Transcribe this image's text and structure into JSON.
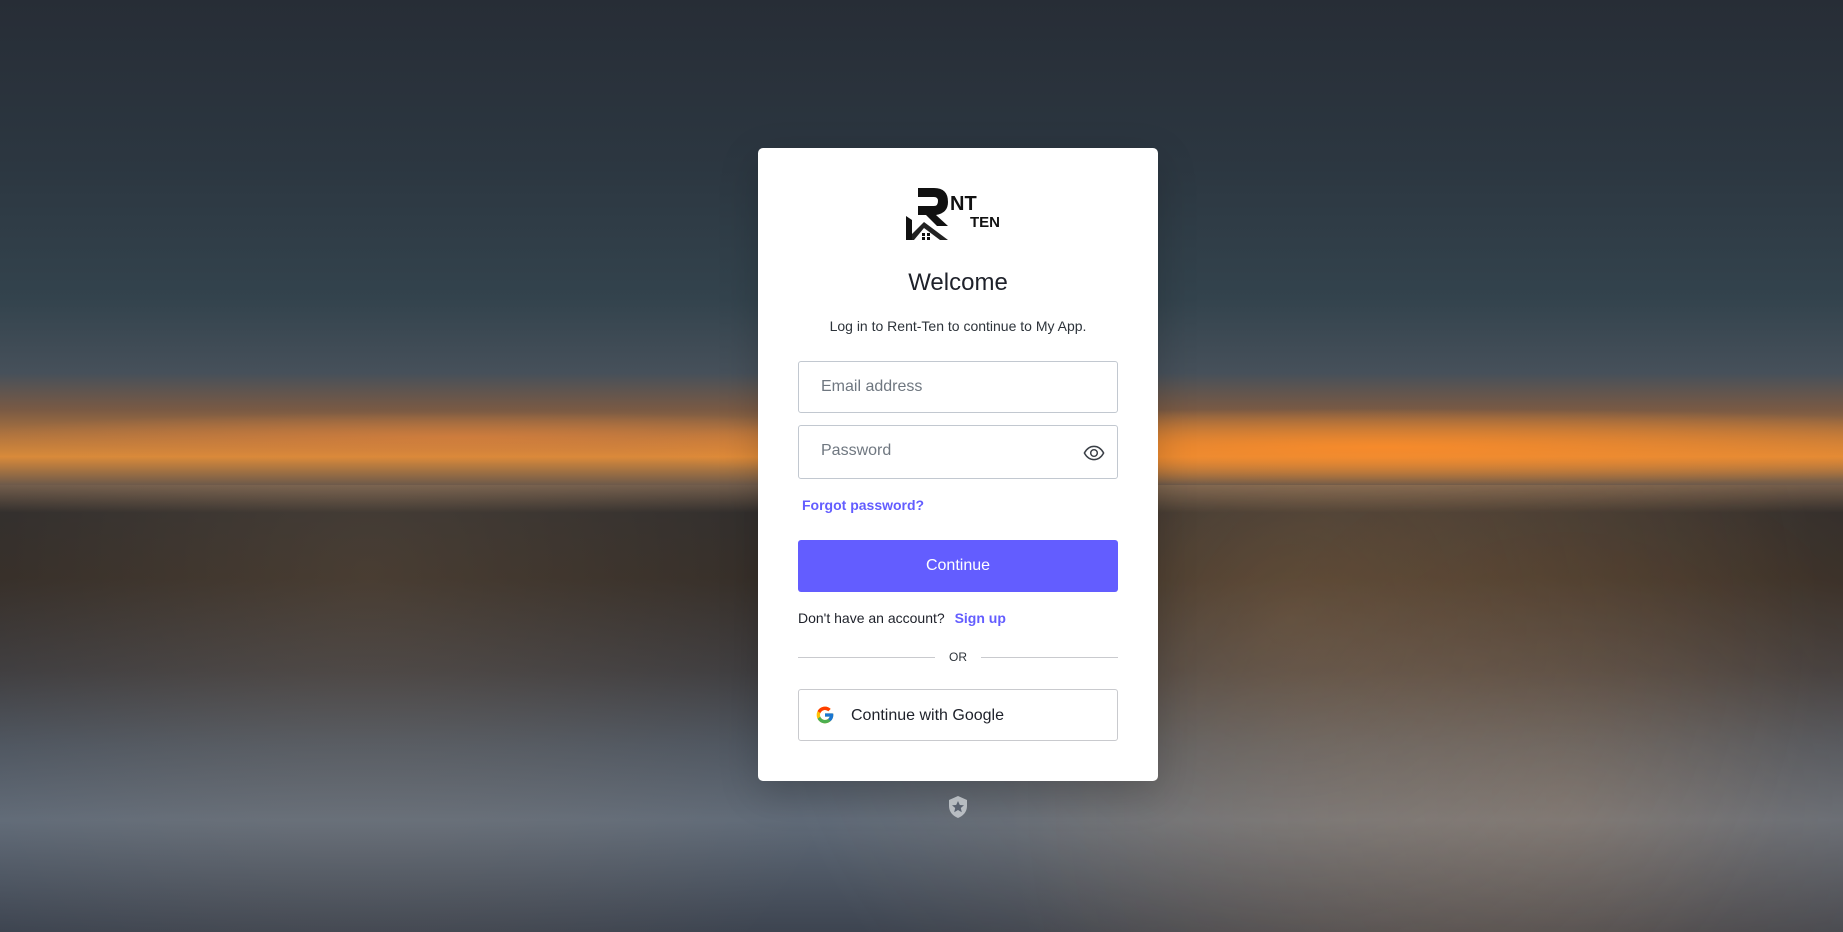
{
  "background": {
    "scene": "city-night-skyline"
  },
  "login": {
    "logo_text": "RENT TEN",
    "title": "Welcome",
    "subtitle": "Log in to Rent-Ten to continue to My App.",
    "email_placeholder": "Email address",
    "password_placeholder": "Password",
    "forgot_label": "Forgot password?",
    "continue_label": "Continue",
    "no_account_text": "Don't have an account?",
    "signup_label": "Sign up",
    "divider_text": "OR",
    "google_label": "Continue with Google"
  },
  "colors": {
    "accent": "#635dff",
    "text": "#1e212a",
    "border": "#c2c8d0"
  },
  "icons": {
    "eye": "eye-icon",
    "google": "google-icon",
    "badge": "auth-badge-icon"
  }
}
